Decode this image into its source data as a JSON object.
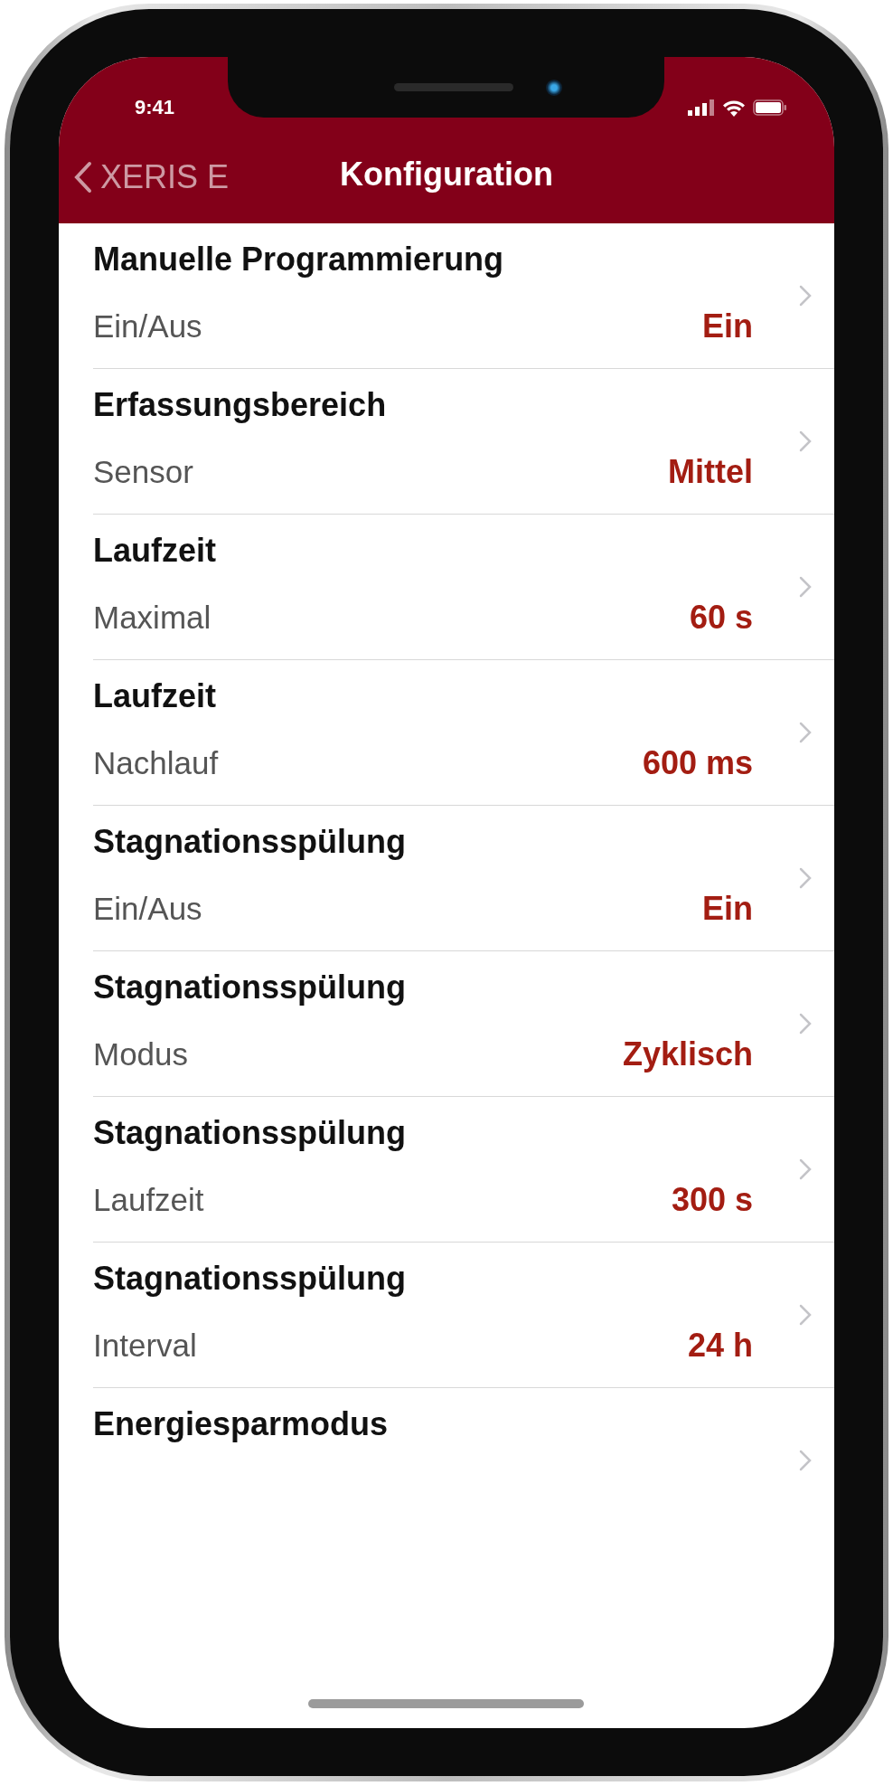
{
  "status_bar": {
    "time": "9:41"
  },
  "nav": {
    "back": "XERIS E",
    "title": "Konfiguration"
  },
  "rows": [
    {
      "title": "Manuelle Programmierung",
      "label": "Ein/Aus",
      "value": "Ein"
    },
    {
      "title": "Erfassungsbereich",
      "label": "Sensor",
      "value": "Mittel"
    },
    {
      "title": "Laufzeit",
      "label": "Maximal",
      "value": "60 s"
    },
    {
      "title": "Laufzeit",
      "label": "Nachlauf",
      "value": "600 ms"
    },
    {
      "title": "Stagnationsspülung",
      "label": "Ein/Aus",
      "value": "Ein"
    },
    {
      "title": "Stagnationsspülung",
      "label": "Modus",
      "value": "Zyklisch"
    },
    {
      "title": "Stagnationsspülung",
      "label": "Laufzeit",
      "value": "300 s"
    },
    {
      "title": "Stagnationsspülung",
      "label": "Interval",
      "value": "24 h"
    },
    {
      "title": "Energiesparmodus"
    }
  ]
}
